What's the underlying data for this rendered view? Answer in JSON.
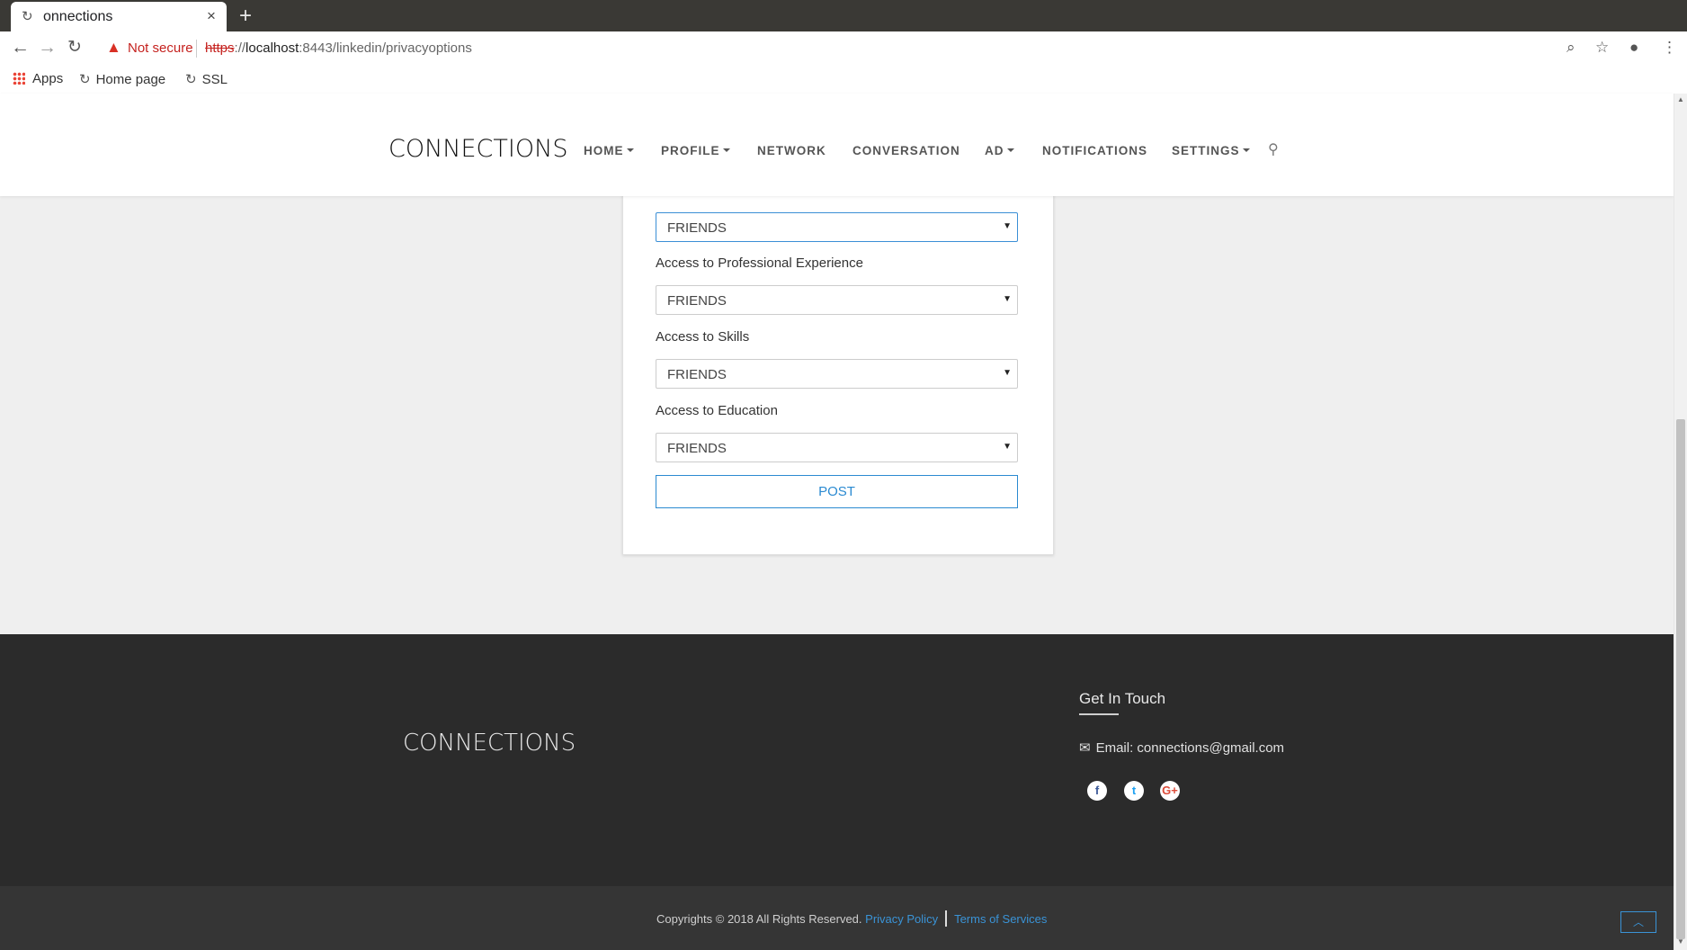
{
  "browser": {
    "tab_title": "onnections",
    "tab_close": "×",
    "new_tab": "+",
    "security_label": "Not secure",
    "url_scheme": "https",
    "url_host": "localhost",
    "url_rest": ":8443/linkedin/privacyoptions",
    "bookmarks": [
      "Apps",
      "Home page",
      "SSL"
    ]
  },
  "header": {
    "logo": "CONNECTIONS",
    "nav": [
      {
        "label": "HOME",
        "dropdown": true
      },
      {
        "label": "PROFILE",
        "dropdown": true
      },
      {
        "label": "NETWORK",
        "dropdown": false
      },
      {
        "label": "CONVERSATION",
        "dropdown": false
      },
      {
        "label": "AD",
        "dropdown": true
      },
      {
        "label": "NOTIFICATIONS",
        "dropdown": false
      },
      {
        "label": "SETTINGS",
        "dropdown": true
      }
    ]
  },
  "form": {
    "selects": [
      {
        "value": "FRIENDS"
      },
      {
        "label": "Access to Professional Experience",
        "value": "FRIENDS"
      },
      {
        "label": "Access to Skills",
        "value": "FRIENDS"
      },
      {
        "label": "Access to Education",
        "value": "FRIENDS"
      }
    ],
    "submit_label": "POST"
  },
  "footer": {
    "logo": "CONNECTIONS",
    "contact_title": "Get In Touch",
    "email_text": "Email: connections@gmail.com",
    "social": [
      "facebook",
      "twitter",
      "google-plus"
    ],
    "copyright": "Copyrights © 2018 All Rights Reserved.",
    "privacy_link": "Privacy Policy",
    "terms_link": "Terms of Services"
  },
  "colors": {
    "accent": "#2b8ad1",
    "footer_bg": "#2b2b2b",
    "bottombar_bg": "#353535"
  }
}
